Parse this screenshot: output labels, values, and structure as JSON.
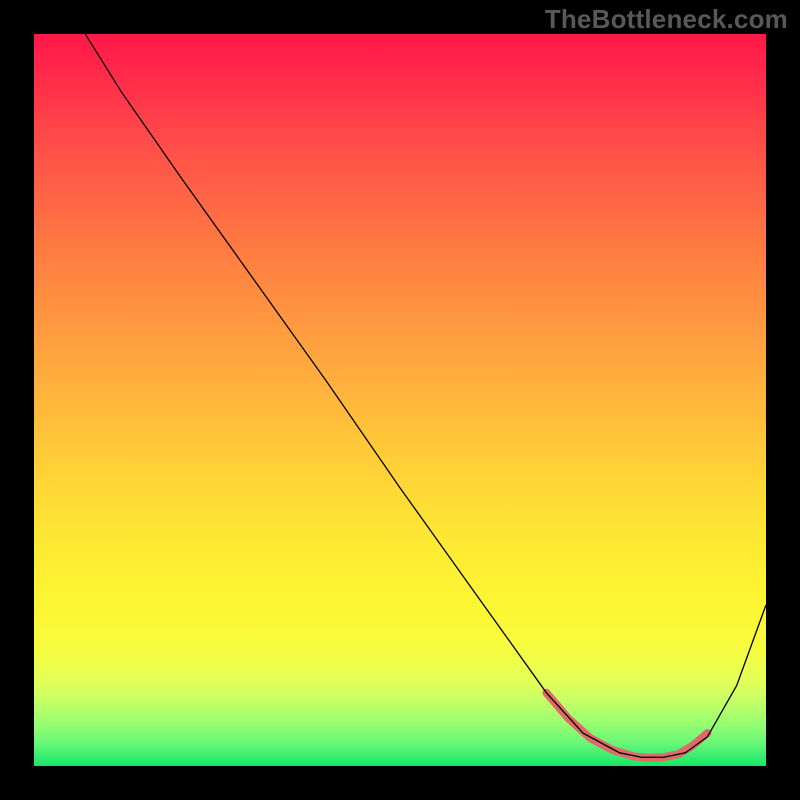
{
  "watermark": "TheBottleneck.com",
  "chart_data": {
    "type": "line",
    "title": "",
    "xlabel": "",
    "ylabel": "",
    "xlim": [
      0,
      100
    ],
    "ylim": [
      0,
      100
    ],
    "grid": false,
    "annotations": [],
    "series": [
      {
        "name": "curve",
        "stroke": "#000000",
        "stroke_width": 1.3,
        "x": [
          7,
          12,
          20,
          30,
          40,
          50,
          60,
          70,
          75,
          80,
          83,
          86,
          89,
          92,
          96,
          100
        ],
        "y": [
          100,
          92,
          80.5,
          66.5,
          52.5,
          38,
          24,
          10,
          4.5,
          1.8,
          1.2,
          1.2,
          1.8,
          4,
          11,
          22
        ]
      },
      {
        "name": "highlight",
        "stroke": "#e06a6a",
        "stroke_width": 8,
        "linecap": "round",
        "x": [
          70,
          73,
          76,
          79,
          82,
          84,
          86,
          88,
          90,
          92
        ],
        "y": [
          10,
          6.5,
          3.8,
          2.2,
          1.3,
          1.1,
          1.2,
          1.6,
          2.8,
          4.5
        ]
      }
    ]
  }
}
